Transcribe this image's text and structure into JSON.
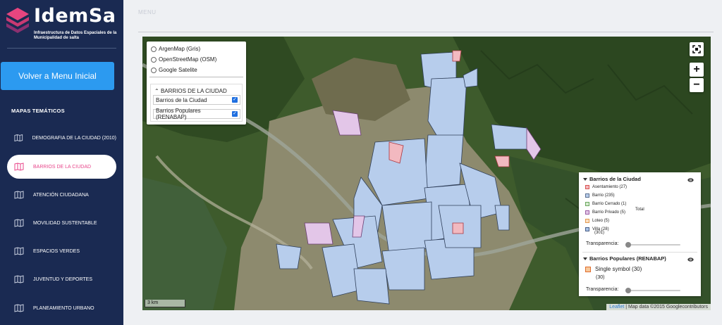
{
  "brand": {
    "name": "IdemSa",
    "subtitle": "Infraestructura de Datos Espaciales de la Municipalidad de salta"
  },
  "sidebar": {
    "back_button": "Volver a Menu Inicial",
    "section_title": "MAPAS TEMÁTICOS",
    "items": [
      {
        "label": "DEMOGRAFIA DE LA CIUDAD (2010)",
        "icon": "map-icon",
        "active": false
      },
      {
        "label": "BARRIOS DE LA CIUDAD",
        "icon": "map-icon",
        "active": true
      },
      {
        "label": "ATENCIÓN CIUDADANA",
        "icon": "map-icon",
        "active": false
      },
      {
        "label": "MOVILIDAD SUSTENTABLE",
        "icon": "map-icon",
        "active": false
      },
      {
        "label": "ESPACIOS VERDES",
        "icon": "map-icon",
        "active": false
      },
      {
        "label": "JUVENTUD Y DEPORTES",
        "icon": "map-icon",
        "active": false
      },
      {
        "label": "PLANEAMIENTO URBANO",
        "icon": "map-icon",
        "active": false
      }
    ]
  },
  "header": {
    "menu_label": "MENU"
  },
  "map": {
    "base_layers": [
      "ArgenMap (Gris)",
      "OpenStreetMap (OSM)",
      "Google Satelite"
    ],
    "overlay_group": "BARRIOS DE LA CIUDAD",
    "overlays": [
      {
        "label": "Barrios de la Ciudad",
        "checked": true
      },
      {
        "label": "Barrios Populares (RENABAP)",
        "checked": true
      }
    ],
    "zoom_in": "+",
    "zoom_out": "−",
    "scale": "3 km",
    "attribution": {
      "leaflet": "Leaflet",
      "separator": " | ",
      "mapdata": "Map data ©2015 Google",
      "contributors": "contributors"
    }
  },
  "legend": {
    "group1": {
      "title": "Barrios de la Ciudad",
      "items": [
        {
          "label": "Asentamiento (27)",
          "color": "#f2b9c0",
          "border": "#d9534f"
        },
        {
          "label": "Barrio (235)",
          "color": "#b8cdeb",
          "border": "#5a6f90"
        },
        {
          "label": "Barrio Cerrado (1)",
          "color": "#d7ecd0",
          "border": "#6aa55f"
        },
        {
          "label": "Barrio Privado (5)",
          "color": "#e3c6e8",
          "border": "#9b5fa5"
        },
        {
          "label": "Loteo (5)",
          "color": "#fbe0c3",
          "border": "#e39a52"
        },
        {
          "label": "Villa (28)",
          "color": "#a9c2e6",
          "border": "#4a5f86"
        }
      ],
      "total_label": "Total",
      "total_value": "(301)",
      "transparency_label": "Transparencia:",
      "transparency": 0
    },
    "group2": {
      "title": "Barrios Populares (RENABAP)",
      "symbol_label": "Single symbol (30)",
      "symbol_color": "#f7c99c",
      "symbol_border": "#e06c2c",
      "total_value": "(30)",
      "transparency_label": "Transparencia:",
      "transparency": 0
    }
  }
}
